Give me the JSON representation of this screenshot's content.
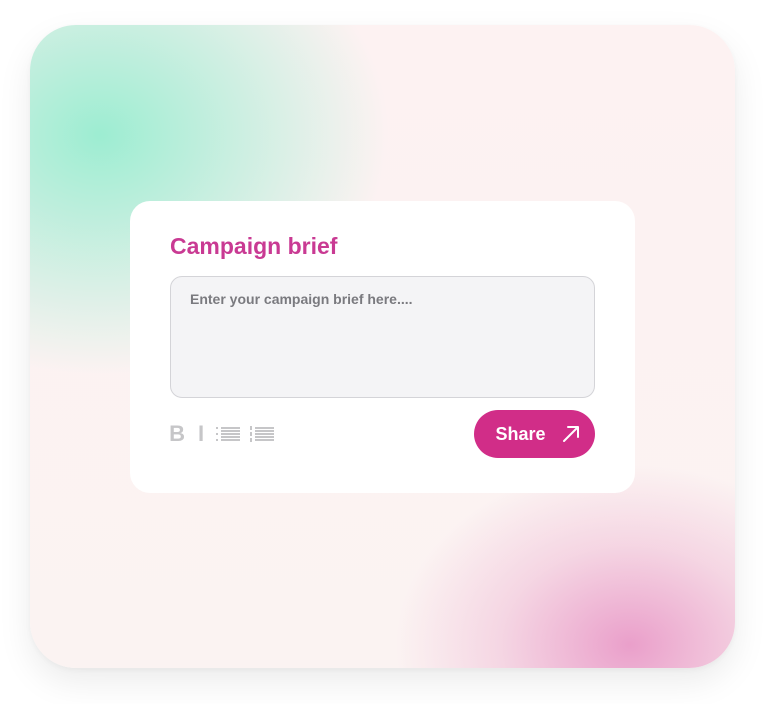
{
  "brief_card": {
    "title": "Campaign brief",
    "brief_input": {
      "value": "",
      "placeholder": "Enter your campaign brief here...."
    },
    "toolbar": {
      "bold_label": "B",
      "italic_label": "I",
      "bulleted_list_icon": "bulleted-list-icon",
      "numbered_list_icon": "numbered-list-icon"
    },
    "share_button": {
      "label": "Share",
      "icon": "arrow-up-right-icon"
    }
  },
  "colors": {
    "accent": "#d12d88",
    "title": "#c93a93",
    "field_background": "#f4f4f6",
    "toolbar_icons": "#c6c6c8"
  }
}
